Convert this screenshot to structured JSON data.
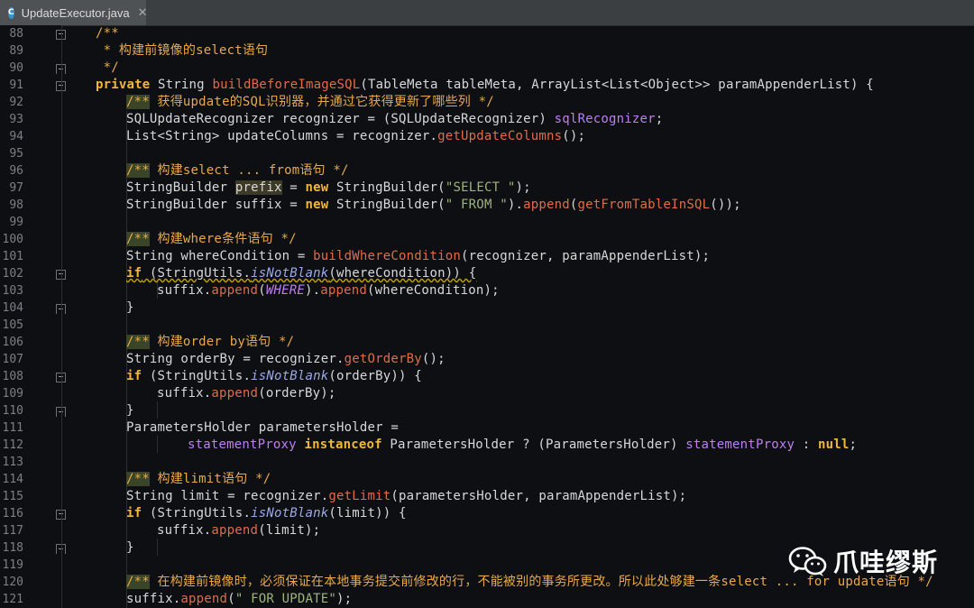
{
  "tab": {
    "title": "UpdateExecutor.java",
    "icon_letter": "C",
    "close": "✕"
  },
  "line_numbers": [
    "88",
    "89",
    "90",
    "91",
    "92",
    "93",
    "94",
    "95",
    "96",
    "97",
    "98",
    "99",
    "100",
    "101",
    "102",
    "103",
    "104",
    "105",
    "106",
    "107",
    "108",
    "109",
    "110",
    "111",
    "112",
    "113",
    "114",
    "115",
    "116",
    "117",
    "118",
    "119",
    "120",
    "121"
  ],
  "watermark": {
    "text": "爪哇缪斯",
    "icon": "wechat-icon"
  },
  "colors": {
    "background": "#0d0f12",
    "keyword": "#f0b73a",
    "comment": "#e8a94a",
    "method": "#e06c4a",
    "string": "#9fb37c",
    "field": "#bf7ef2"
  },
  "code": {
    "l88": "/**",
    "l89": " * 构建前镜像的select语句",
    "l90": " */",
    "l91": [
      "private",
      " String ",
      "buildBeforeImageSQL",
      "(TableMeta tableMeta, ArrayList<List<Object>> paramAppenderList) {"
    ],
    "l92": [
      "/**",
      " 获得update的SQL识别器，并通过它获得更新了哪些列 */"
    ],
    "l93": [
      "SQLUpdateRecognizer recognizer = (SQLUpdateRecognizer) ",
      "sqlRecognizer",
      ";"
    ],
    "l94": [
      "List<String> updateColumns = recognizer.",
      "getUpdateColumns",
      "();"
    ],
    "l96": [
      "/**",
      " 构建select ... from语句 */"
    ],
    "l97": [
      "StringBuilder ",
      "prefix",
      " = ",
      "new",
      " StringBuilder(",
      "\"SELECT \"",
      ");"
    ],
    "l98": [
      "StringBuilder suffix = ",
      "new",
      " StringBuilder(",
      "\" FROM \"",
      ").",
      "append",
      "(",
      "getFromTableInSQL",
      "());"
    ],
    "l100": [
      "/**",
      " 构建where条件语句 */"
    ],
    "l101": [
      "String whereCondition = ",
      "buildWhereCondition",
      "(recognizer, paramAppenderList);"
    ],
    "l102": [
      "if",
      " (StringUtils.",
      "isNotBlank",
      "(whereCondition)) {"
    ],
    "l103": [
      "suffix.",
      "append",
      "(",
      "WHERE",
      ").",
      "append",
      "(whereCondition);"
    ],
    "l104": "}",
    "l106": [
      "/**",
      " 构建order by语句 */"
    ],
    "l107": [
      "String orderBy = recognizer.",
      "getOrderBy",
      "();"
    ],
    "l108": [
      "if",
      " (StringUtils.",
      "isNotBlank",
      "(orderBy)) {"
    ],
    "l109": [
      "suffix.",
      "append",
      "(orderBy);"
    ],
    "l110": "}",
    "l111": "ParametersHolder parametersHolder =",
    "l112": [
      "statementProxy",
      " ",
      "instanceof",
      " ParametersHolder ? (ParametersHolder) ",
      "statementProxy",
      " : ",
      "null",
      ";"
    ],
    "l114": [
      "/**",
      " 构建limit语句 */"
    ],
    "l115": [
      "String limit = recognizer.",
      "getLimit",
      "(parametersHolder, paramAppenderList);"
    ],
    "l116": [
      "if",
      " (StringUtils.",
      "isNotBlank",
      "(limit)) {"
    ],
    "l117": [
      "suffix.",
      "append",
      "(limit);"
    ],
    "l118": "}",
    "l120": [
      "/**",
      " 在构建前镜像时，必须保证在本地事务提交前修改的行，不能被别的事务所更改。所以此处够建一条select ... for update语句 */"
    ],
    "l121": [
      "suffix.",
      "append",
      "(",
      "\" FOR UPDATE\"",
      ");"
    ]
  }
}
